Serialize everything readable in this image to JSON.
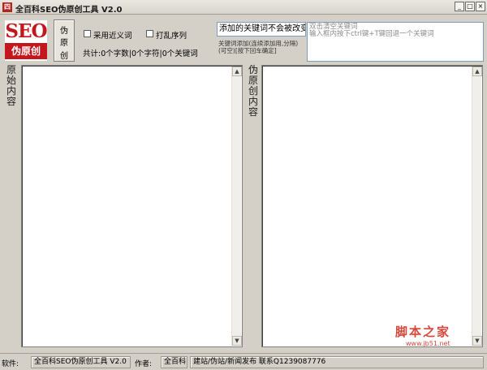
{
  "window": {
    "icon_text": "四",
    "title": "全百科SEO伪原创工具 V2.0",
    "min_glyph": "_",
    "max_glyph": "□",
    "close_glyph": "×"
  },
  "logo": {
    "line1": "SEO",
    "line2": "伪原创"
  },
  "toolbar": {
    "pseudo_button": [
      "伪",
      "原",
      "创"
    ],
    "synonym_label": "采用近义词",
    "shuffle_label": "打乱序列",
    "stats": "共计:0个字数|0个字符|0个关键词"
  },
  "keywords": {
    "lock_value": "添加的关键词不会被改变",
    "lock_note": "关键词添加(连续添加用,分隔)(可空)[按下回车确定]",
    "hint_line1": "双击清空关键词",
    "hint_line2": "输入框内按下ctrl键+T键回退一个关键词"
  },
  "panels": {
    "original_label": "原始内容",
    "pseudo_label": "伪原创内容",
    "original_text": "",
    "pseudo_text": "",
    "scroll_up": "▲",
    "scroll_down": "▼"
  },
  "statusbar": {
    "software_label": "软件:",
    "software_value": "全百科SEO伪原创工具 V2.0",
    "author_label": "作者:",
    "author_value": "全百科",
    "site_info": "建站/伪站/新闻发布 联系Q1239087776"
  },
  "watermark": {
    "text": "脚本之家",
    "url": "www.jb51.net"
  }
}
